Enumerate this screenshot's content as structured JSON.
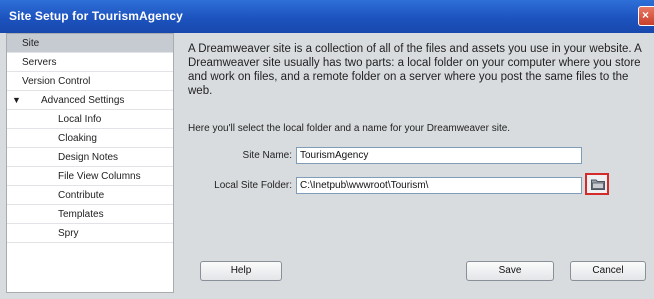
{
  "window": {
    "title": "Site Setup for TourismAgency"
  },
  "sidebar": {
    "items": [
      {
        "label": "Site",
        "selected": true
      },
      {
        "label": "Servers"
      },
      {
        "label": "Version Control"
      },
      {
        "label": "Advanced Settings",
        "expanded": true
      },
      {
        "label": "Local Info"
      },
      {
        "label": "Cloaking"
      },
      {
        "label": "Design Notes"
      },
      {
        "label": "File View Columns"
      },
      {
        "label": "Contribute"
      },
      {
        "label": "Templates"
      },
      {
        "label": "Spry"
      }
    ]
  },
  "main": {
    "intro": "A Dreamweaver site is a collection of all of the files and assets you use in your website. A Dreamweaver site usually has two parts: a local folder on your computer where you store and work on files, and a remote folder on a server where you post the same files to the web.",
    "hint": "Here you'll select the local folder and a name for your Dreamweaver site.",
    "site_name": {
      "label": "Site Name:",
      "value": "TourismAgency"
    },
    "local_folder": {
      "label": "Local Site Folder:",
      "value": "C:\\Inetpub\\wwwroot\\Tourism\\"
    }
  },
  "buttons": {
    "help": "Help",
    "save": "Save",
    "cancel": "Cancel"
  },
  "icons": {
    "close": "close-icon",
    "browse": "folder-icon",
    "expand": "triangle-down-icon"
  },
  "colors": {
    "titlebar": "#1d53bf",
    "highlight": "#d42a2a",
    "selected": "#c6cbd1"
  }
}
